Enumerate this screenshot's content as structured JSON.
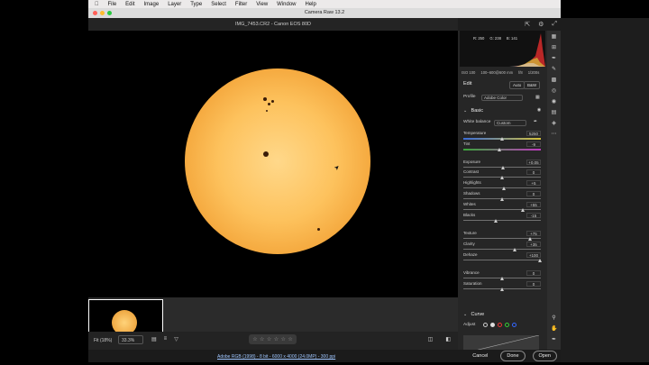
{
  "menubar": {
    "items": [
      "Photoshop",
      "File",
      "Edit",
      "Image",
      "Layer",
      "Type",
      "Select",
      "Filter",
      "View",
      "Window",
      "Help"
    ]
  },
  "window": {
    "title": "Camera Raw 13.2"
  },
  "document": {
    "filename": "IMG_7453.CR2  -  Canon EOS 80D"
  },
  "histogram": {
    "r": "R: 250",
    "g": "G: 238",
    "b": "B: 141"
  },
  "exif": {
    "iso": "ISO 100",
    "lens": "100–600@600 mm",
    "fstop": "f/8",
    "shutter": "1/200s"
  },
  "edit": {
    "title": "Edit",
    "auto": "Auto",
    "bw": "B&W",
    "profile_label": "Profile",
    "profile_value": "Adobe Color",
    "basic_title": "Basic",
    "wb_label": "White balance",
    "wb_value": "Custom"
  },
  "sliders": [
    {
      "label": "Temperature",
      "value": "5250",
      "pos": 0.5,
      "gradient": "linear-gradient(90deg,#3a6cd6,#d6c33a)"
    },
    {
      "label": "Tint",
      "value": "-9",
      "pos": 0.47,
      "gradient": "linear-gradient(90deg,#3aa63a,#c03ac0)"
    },
    {
      "label": "Exposure",
      "value": "+0.05",
      "pos": 0.51
    },
    {
      "label": "Contrast",
      "value": "0",
      "pos": 0.5
    },
    {
      "label": "Highlights",
      "value": "+5",
      "pos": 0.52
    },
    {
      "label": "Shadows",
      "value": "0",
      "pos": 0.5
    },
    {
      "label": "Whites",
      "value": "+55",
      "pos": 0.77
    },
    {
      "label": "Blacks",
      "value": "-15",
      "pos": 0.42
    },
    {
      "label": "Texture",
      "value": "+75",
      "pos": 0.87
    },
    {
      "label": "Clarity",
      "value": "+35",
      "pos": 0.67
    },
    {
      "label": "Dehaze",
      "value": "+100",
      "pos": 1.0
    },
    {
      "label": "Vibrance",
      "value": "0",
      "pos": 0.5
    },
    {
      "label": "Saturation",
      "value": "0",
      "pos": 0.5
    }
  ],
  "curve": {
    "title": "Curve",
    "adjust_label": "Adjust"
  },
  "bottombar": {
    "fit_label": "Fit (18%)",
    "zoom_value": "33.3%"
  },
  "footer": {
    "info": "Adobe RGB (1998) - 8 bit - 6000 x 4000 (24.0MP) - 300 ppi",
    "cancel": "Cancel",
    "done": "Done",
    "open": "Open"
  }
}
